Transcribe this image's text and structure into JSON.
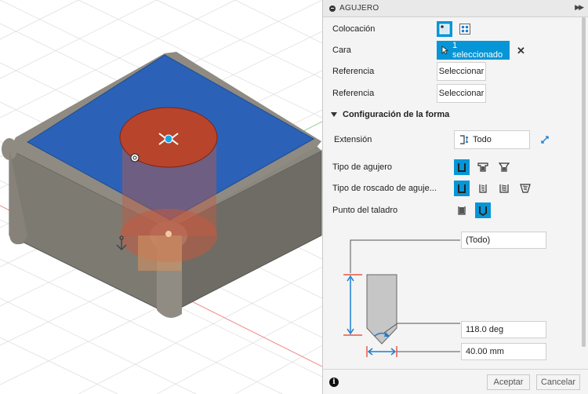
{
  "panel": {
    "title": "AGUJERO",
    "placement_label": "Colocación",
    "face_label": "Cara",
    "face_value": "1 seleccionado",
    "reference1_label": "Referencia",
    "reference1_button": "Seleccionar",
    "reference2_label": "Referencia",
    "reference2_button": "Seleccionar",
    "shape_section": "Configuración de la forma",
    "extent_label": "Extensión",
    "extent_value": "Todo",
    "hole_type_label": "Tipo de agujero",
    "tap_type_label": "Tipo de roscado de aguje...",
    "drill_point_label": "Punto del taladro",
    "depth_value": "(Todo)",
    "angle_value": "118.0 deg",
    "diameter_value": "40.00 mm",
    "ok_label": "Aceptar",
    "cancel_label": "Cancelar"
  },
  "colors": {
    "accent": "#0696d7",
    "face_blue": "#2b62b8",
    "hole_red": "#b8442c",
    "body_gray": "#7d7a72"
  },
  "icons": [
    "collapse-icon",
    "expand-icon",
    "point-placement-icon",
    "multi-point-icon",
    "cursor-icon",
    "close-icon",
    "extent-all-icon",
    "flip-icon",
    "simple-hole-icon",
    "counterbore-icon",
    "countersink-icon",
    "tap-simple-icon",
    "tap-clearance-icon",
    "tap-tapped-icon",
    "tap-taper-icon",
    "drill-flat-icon",
    "drill-angle-icon",
    "info-icon"
  ]
}
